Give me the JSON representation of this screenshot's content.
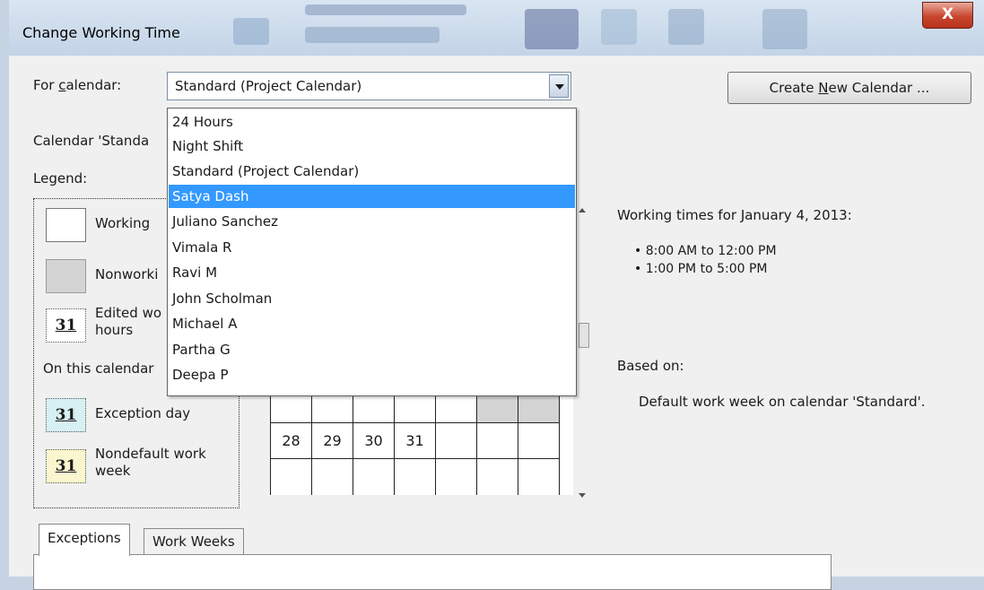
{
  "window": {
    "title": "Change Working Time",
    "close_glyph": "X"
  },
  "for_calendar": {
    "label_prefix": "For ",
    "label_accel": "c",
    "label_suffix": "alendar:",
    "selected_value": "Standard (Project Calendar)"
  },
  "create_button": {
    "prefix": "Create ",
    "accel": "N",
    "suffix": "ew Calendar ..."
  },
  "calendar_info_partial": "Calendar 'Standa",
  "legend": {
    "title": "Legend:",
    "working": "Working",
    "nonworking": "Nonworki",
    "edited_line1": "Edited wo",
    "edited_line2": "hours",
    "on_this_calendar": "On this calendar",
    "exception_day": "Exception day",
    "nondefault_line1": "Nondefault work",
    "nondefault_line2": "week",
    "swatch_number": "31"
  },
  "dropdown": {
    "items": [
      "24 Hours",
      "Night Shift",
      "Standard (Project Calendar)",
      "Satya Dash",
      "Juliano Sanchez",
      "Vimala R",
      "Ravi M",
      "John Scholman",
      "Michael A",
      "Partha G",
      "Deepa P"
    ],
    "highlighted_index": 3
  },
  "calendar_grid": {
    "row_dates": [
      "28",
      "29",
      "30",
      "31",
      "",
      "",
      ""
    ]
  },
  "working_times": {
    "heading": "Working times for January 4, 2013:",
    "times": [
      "8:00 AM to 12:00 PM",
      "1:00 PM to 5:00 PM"
    ],
    "based_on_label": "Based on:",
    "based_on_text": "Default work week on calendar 'Standard'."
  },
  "tabs": {
    "items": [
      "Exceptions",
      "Work Weeks"
    ],
    "active_index": 0
  },
  "colors": {
    "selection": "#3399ff",
    "nonworking_swatch": "#d4d4d4",
    "exception_swatch": "#d7f0f4",
    "nondefault_swatch": "#fbf6cf",
    "close_button": "#c8462f"
  }
}
